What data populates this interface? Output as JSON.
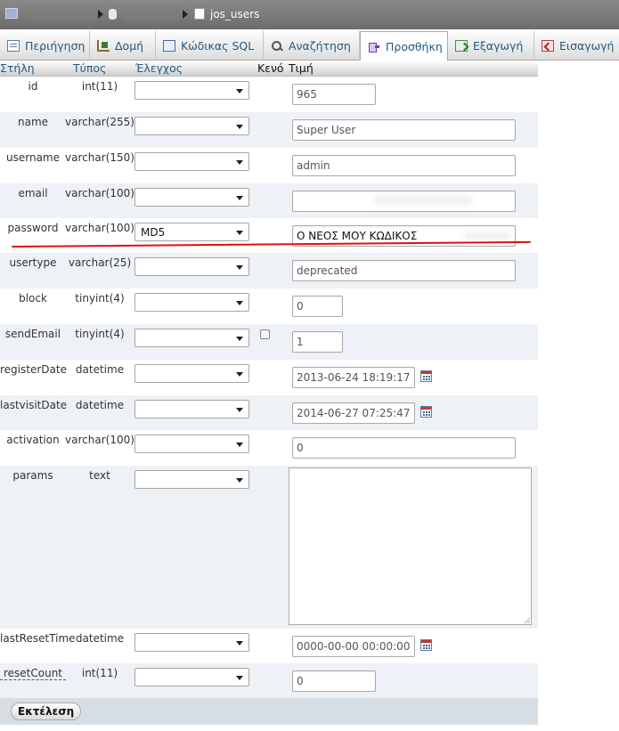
{
  "breadcrumb": {
    "table_name": "jos_users"
  },
  "tabs": [
    {
      "label": "Περιήγηση",
      "icon": "browse-icon"
    },
    {
      "label": "Δομή",
      "icon": "structure-icon"
    },
    {
      "label": "Κώδικας SQL",
      "icon": "sql-icon"
    },
    {
      "label": "Αναζήτηση",
      "icon": "search-icon"
    },
    {
      "label": "Προσθήκη",
      "icon": "insert-icon",
      "active": true
    },
    {
      "label": "Εξαγωγή",
      "icon": "export-icon"
    },
    {
      "label": "Εισαγωγή",
      "icon": "import-icon"
    }
  ],
  "table_header": {
    "column": "Στήλη",
    "type": "Τύπος",
    "function": "Έλεγχος",
    "null": "Κενό",
    "value": "Τιμή"
  },
  "fields": [
    {
      "name": "id",
      "type": "int(11)",
      "function": "",
      "value": "965"
    },
    {
      "name": "name",
      "type": "varchar(255)",
      "function": "",
      "value": "Super User"
    },
    {
      "name": "username",
      "type": "varchar(150)",
      "function": "",
      "value": "admin"
    },
    {
      "name": "email",
      "type": "varchar(100)",
      "function": "",
      "value": ""
    },
    {
      "name": "password",
      "type": "varchar(100)",
      "function": "MD5",
      "value": "Ο ΝΕΟΣ ΜΟΥ ΚΩΔΙΚΟΣ"
    },
    {
      "name": "usertype",
      "type": "varchar(25)",
      "function": "",
      "value": "deprecated"
    },
    {
      "name": "block",
      "type": "tinyint(4)",
      "function": "",
      "value": "0"
    },
    {
      "name": "sendEmail",
      "type": "tinyint(4)",
      "function": "",
      "value": "1"
    },
    {
      "name": "registerDate",
      "type": "datetime",
      "function": "",
      "value": "2013-06-24 18:19:17"
    },
    {
      "name": "lastvisitDate",
      "type": "datetime",
      "function": "",
      "value": "2014-06-27 07:25:47"
    },
    {
      "name": "activation",
      "type": "varchar(100)",
      "function": "",
      "value": "0"
    },
    {
      "name": "params",
      "type": "text",
      "function": "",
      "value": ""
    },
    {
      "name": "lastResetTime",
      "type": "datetime",
      "function": "",
      "value": "0000-00-00 00:00:00"
    },
    {
      "name": "resetCount",
      "type": "int(11)",
      "function": "",
      "value": "0"
    }
  ],
  "footer": {
    "go_label": "Εκτέλεση"
  },
  "colors": {
    "link": "#235a81",
    "annotation_line": "#e01010",
    "row_alt": "#eef1f5"
  }
}
